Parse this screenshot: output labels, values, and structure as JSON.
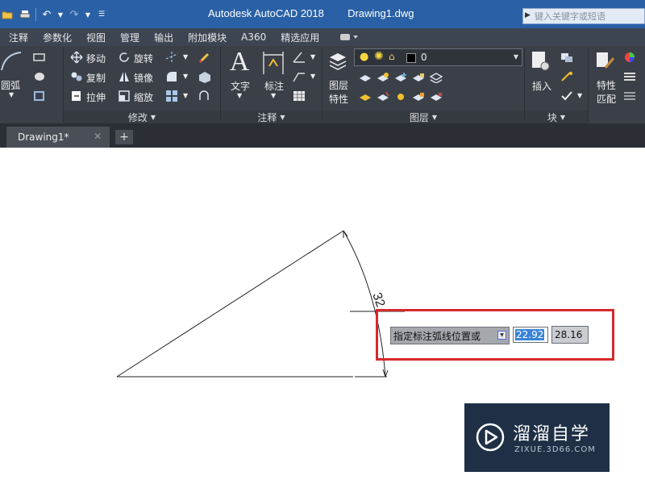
{
  "titlebar": {
    "app_title": "Autodesk AutoCAD 2018",
    "file_name": "Drawing1.dwg",
    "search_placeholder": "键入关键字或短语",
    "qat_icons": [
      "open-folder-icon",
      "print-icon",
      "undo-icon",
      "redo-icon",
      "customize-icon"
    ]
  },
  "menubar": {
    "items": [
      "注释",
      "参数化",
      "视图",
      "管理",
      "输出",
      "附加模块",
      "A360",
      "精选应用"
    ]
  },
  "ribbon": {
    "draw": {
      "arc_label": "圆弧"
    },
    "modify": {
      "title": "修改",
      "move": "移动",
      "rotate": "旋转",
      "copy": "复制",
      "mirror": "镜像",
      "stretch": "拉伸",
      "scale": "缩放"
    },
    "annotation": {
      "title": "注释",
      "text": "文字",
      "dimension": "标注"
    },
    "layers": {
      "title": "图层",
      "properties_line1": "图层",
      "properties_line2": "特性",
      "current_layer": "0"
    },
    "block": {
      "title": "块",
      "insert": "插入"
    },
    "properties": {
      "match_line1": "特性",
      "match_line2": "匹配"
    }
  },
  "tabs": {
    "drawing_tab": "Drawing1*",
    "close_glyph": "✕",
    "new_tab_glyph": "+"
  },
  "drawing": {
    "dimension_text": "32",
    "prompt_text": "指定标注弧线位置或",
    "input_value_1": "22.92",
    "input_value_2": "28.16"
  },
  "watermark": {
    "title": "溜溜自学",
    "subtitle": "ZIXUE.3D66.COM"
  },
  "colors": {
    "titlebar": "#2a61a6",
    "ribbon": "#3b4048",
    "highlight": "#d8292c",
    "selection": "#3a84d8"
  }
}
